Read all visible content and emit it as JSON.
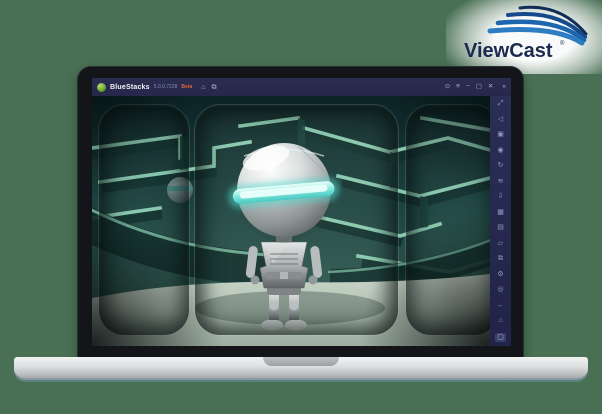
{
  "page": {
    "background_color": "#497054"
  },
  "brand": {
    "name": "ViewCast",
    "registered_mark": "®",
    "text_color": "#1b2a4e",
    "swoosh_colors": [
      "#122d56",
      "#154a8c",
      "#1d66ae",
      "#2e7cc2"
    ]
  },
  "laptop": {
    "bezel_color": "#131519",
    "base_color": "#dddfe0"
  },
  "bluestacks": {
    "titlebar": {
      "background_color": "#25284a",
      "app_name": "BlueStacks",
      "version": "5.0.0.7228",
      "beta_badge": "Beta",
      "left_icons": [
        {
          "name": "home-icon",
          "glyph": "⌂"
        },
        {
          "name": "multi-window-icon",
          "glyph": "⧉"
        }
      ],
      "right_icons": [
        {
          "name": "record-icon",
          "glyph": "⊙"
        },
        {
          "name": "menu-icon",
          "glyph": "≡"
        },
        {
          "name": "minimize-icon",
          "glyph": "−"
        },
        {
          "name": "maximize-icon",
          "glyph": "▢"
        },
        {
          "name": "close-icon",
          "glyph": "✕"
        },
        {
          "name": "collapse-sidebar-icon",
          "glyph": "«"
        }
      ]
    },
    "sidebar": {
      "background_color": "#262a4e",
      "icons": [
        {
          "name": "fullscreen-icon",
          "glyph": "⤢"
        },
        {
          "name": "volume-icon",
          "glyph": "◁"
        },
        {
          "name": "screenshot-icon",
          "glyph": "▣"
        },
        {
          "name": "record-screen-icon",
          "glyph": "◉"
        },
        {
          "name": "rotate-icon",
          "glyph": "↻"
        },
        {
          "name": "shake-icon",
          "glyph": "≋"
        },
        {
          "name": "install-apk-icon",
          "glyph": "⇩"
        },
        {
          "name": "gamepad-icon",
          "glyph": "▦"
        },
        {
          "name": "keyboard-controls-icon",
          "glyph": "▤"
        },
        {
          "name": "folder-icon",
          "glyph": "▱"
        },
        {
          "name": "multi-instance-icon",
          "glyph": "⧉"
        },
        {
          "name": "settings-icon",
          "glyph": "⚙"
        },
        {
          "name": "macros-icon",
          "glyph": "◎"
        },
        {
          "name": "back-icon",
          "glyph": "←"
        },
        {
          "name": "home-nav-icon",
          "glyph": "⌂"
        },
        {
          "name": "recents-icon",
          "glyph": "▢"
        }
      ]
    }
  },
  "game": {
    "colors": {
      "maze_dark": "#0d2628",
      "maze_mid": "#1d4440",
      "maze_highlight": "#8fd0b4",
      "floor": "#b7c6b9",
      "visor_glow": "#5fe0d6",
      "robot_silver": "#c7cccd"
    }
  }
}
